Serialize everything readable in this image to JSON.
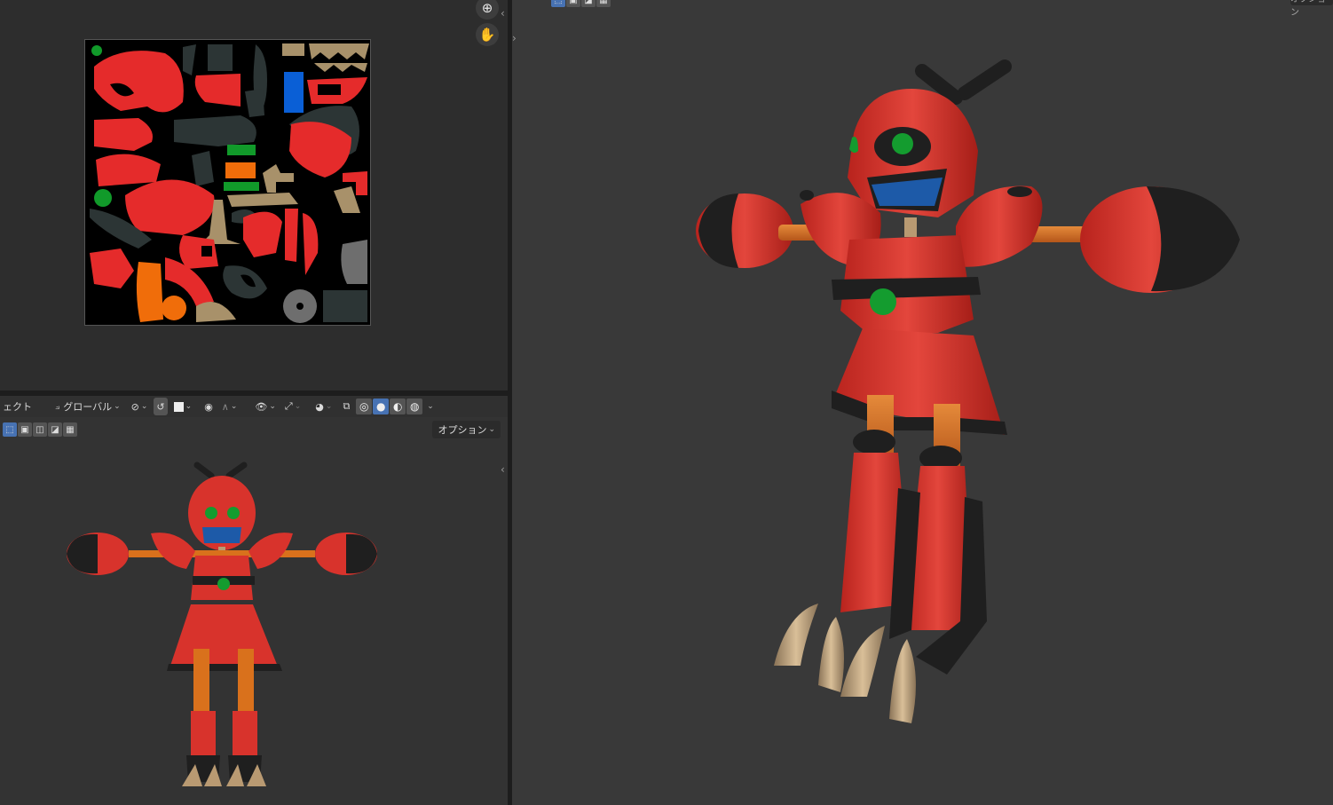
{
  "uv_editor": {
    "zoom_icon": "zoom-in-icon",
    "pan_icon": "hand-pan-icon",
    "texture": {
      "background": "#000000",
      "colors": {
        "red": "#e52b2b",
        "dark": "#2c3535",
        "blue": "#0a5fd6",
        "tan": "#a8916a",
        "orange": "#f06d0a",
        "green": "#119a2a",
        "grey": "#6e6e6e"
      }
    }
  },
  "small_viewport": {
    "header": {
      "mode_label": "ェクト",
      "orientation_label": "グローバル",
      "options_label": "オプション"
    },
    "select_modes": [
      "select-box",
      "select-extend",
      "select-subtract",
      "select-invert",
      "select-intersect"
    ],
    "shading_modes": [
      "wireframe",
      "solid",
      "material",
      "rendered"
    ]
  },
  "main_viewport": {
    "select_modes": [
      "select-box",
      "select-extend",
      "select-subtract",
      "select-invert"
    ],
    "options_stub_label": "オプション"
  },
  "character": {
    "body_color": "#d8332c",
    "dark_color": "#1f1f1f",
    "visor_color": "#1d5aa8",
    "eye_color": "#149c2f",
    "joint_color": "#d9711c",
    "claw_color": "#b99a72"
  }
}
